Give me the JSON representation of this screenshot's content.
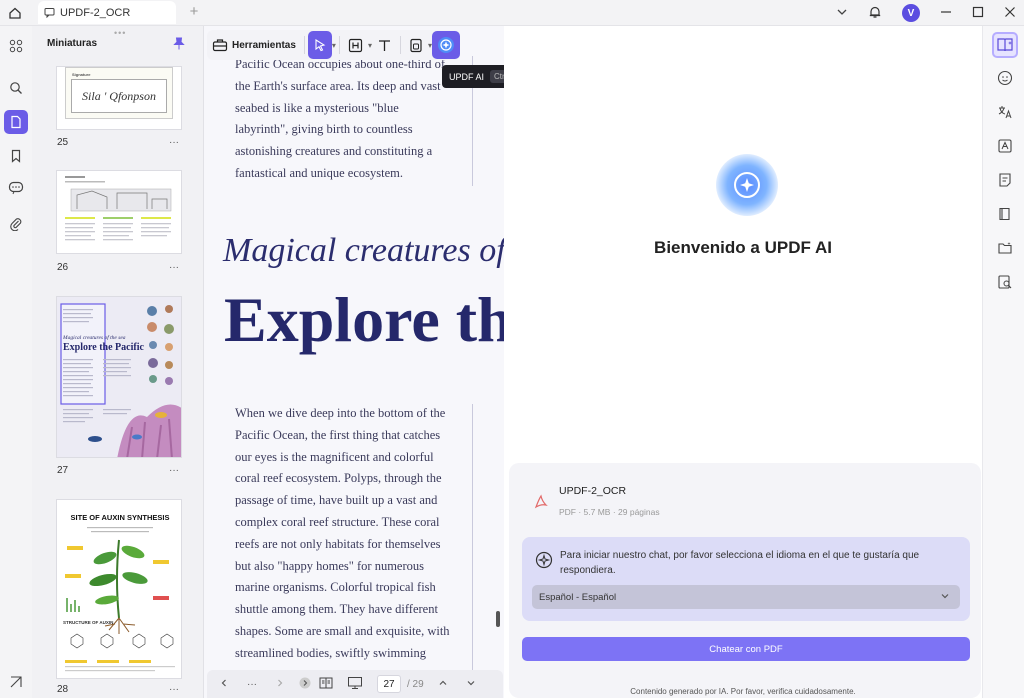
{
  "titlebar": {
    "tab_title": "UPDF-2_OCR",
    "add_tab": "+",
    "avatar_initial": "V"
  },
  "thumbnails": {
    "header": "Miniaturas",
    "grip": "•••",
    "more": "···",
    "pages": [
      {
        "number": "25",
        "sig_label": "Signature",
        "sig_text": "Sila ' Qfonpson"
      },
      {
        "number": "26"
      },
      {
        "number": "27",
        "small_title1": "Magical creatures of the sea",
        "small_title2": "Explore the Pacific"
      },
      {
        "number": "28",
        "title": "SITE OF AUXIN SYNTHESIS",
        "sub": "STRUCTURE OF AUXIN"
      }
    ]
  },
  "toolbar": {
    "tools_label": "Herramientas"
  },
  "tooltip": {
    "label": "UPDF AI",
    "shortcut": "Ctrl+E"
  },
  "document": {
    "para1": [
      "Pacific Ocean occupies about one-third of",
      "the Earth's surface area. Its deep and vast",
      "seabed is like a mysterious \"blue",
      "labyrinth\", giving birth to countless",
      "astonishing creatures and constituting a",
      "fantastical and unique ecosystem."
    ],
    "heading_italic": "Magical creatures of",
    "heading_big": "Explore th",
    "para2": [
      "When we dive deep into the bottom of the",
      "Pacific Ocean, the first thing that catches",
      "our eyes is the magnificent and colorful",
      "coral reef ecosystem. Polyps, through the",
      "passage of time, have built up a vast and",
      "complex coral reef structure. These coral",
      "reefs are not only habitats for themselves",
      "but also \"happy homes\" for numerous",
      "marine organisms. Colorful tropical fish",
      "shuttle among them. They have different",
      "shapes. Some are small and exquisite, with",
      "streamlined bodies, swiftly swimming"
    ]
  },
  "pagebar": {
    "dots": "···",
    "current_page": "27",
    "total": "/ 29"
  },
  "ai_panel": {
    "title": "Bienvenido a UPDF AI",
    "file_name": "UPDF-2_OCR",
    "file_meta": "PDF · 5.7 MB · 29 páginas",
    "prompt": "Para iniciar nuestro chat, por favor selecciona el idioma en el que te gustaría que respondiera.",
    "language": "Español - Español",
    "chat_button": "Chatear con PDF",
    "disclaimer": "Contenido generado por IA. Por favor, verifica cuidadosamente."
  },
  "colors": {
    "accent": "#6b5ce7",
    "heading_navy": "#25286b",
    "chat_button": "#7d73f5"
  }
}
